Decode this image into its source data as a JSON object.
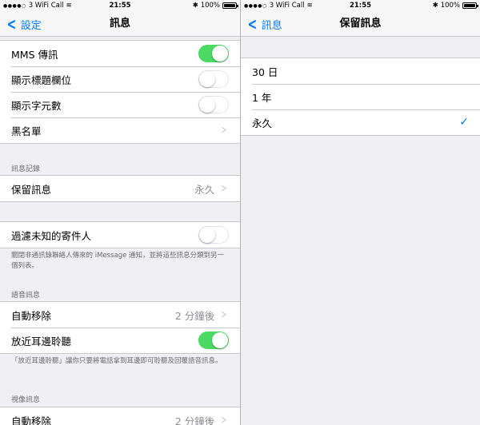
{
  "status": {
    "carrier": "3 WiFi Call",
    "time": "21:55",
    "battery": "100%"
  },
  "left": {
    "back_label": "設定",
    "title": "訊息",
    "group1": [
      {
        "label": "MMS 傳訊",
        "toggle": "on"
      },
      {
        "label": "顯示標題欄位",
        "toggle": "off"
      },
      {
        "label": "顯示字元數",
        "toggle": "off"
      },
      {
        "label": "黑名單"
      }
    ],
    "history_header": "訊息記錄",
    "keep_messages": {
      "label": "保留訊息",
      "value": "永久"
    },
    "filter": {
      "label": "過濾未知的寄件人",
      "toggle": "off"
    },
    "filter_note": "關閉非通訊錄聯絡人傳來的 iMessage 通知，並將這些訊息分類到另一個列表。",
    "audio_header": "語音訊息",
    "audio_expire": {
      "label": "自動移除",
      "value": "2 分鐘後"
    },
    "raise_to_listen": {
      "label": "放近耳邊聆聽",
      "toggle": "on"
    },
    "raise_note": "「放近耳邊聆聽」讓你只要將電話拿到耳邊即可聆聽及回覆語音訊息。",
    "video_header": "視像訊息",
    "video_expire": {
      "label": "自動移除",
      "value": "2 分鐘後"
    }
  },
  "right": {
    "back_label": "訊息",
    "title": "保留訊息",
    "options": [
      {
        "label": "30 日",
        "selected": false
      },
      {
        "label": "1 年",
        "selected": false
      },
      {
        "label": "永久",
        "selected": true
      }
    ]
  },
  "colors": {
    "accent": "#007aff",
    "toggle_on": "#4cd964"
  }
}
